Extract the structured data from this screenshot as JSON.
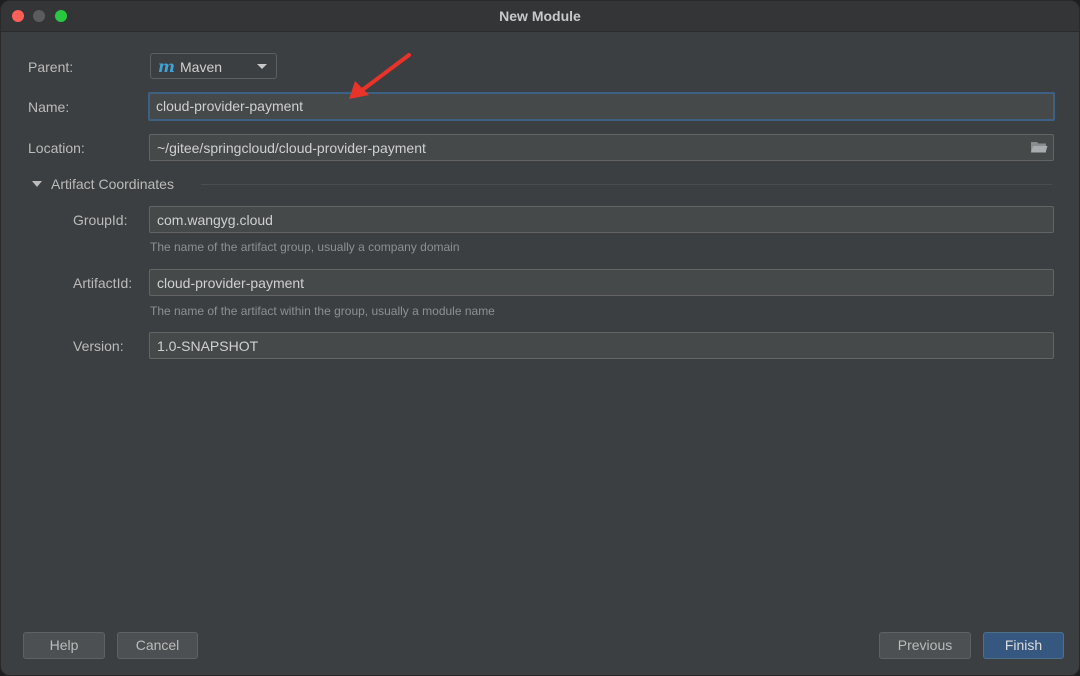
{
  "window": {
    "title": "New Module"
  },
  "form": {
    "parent_label": "Parent:",
    "parent_value": "Maven",
    "parent_icon": "maven-m-icon",
    "name_label": "Name:",
    "name_value": "cloud-provider-payment",
    "location_label": "Location:",
    "location_value": "~/gitee/springcloud/cloud-provider-payment",
    "section_title": "Artifact Coordinates",
    "groupid_label": "GroupId:",
    "groupid_value": "com.wangyg.cloud",
    "groupid_hint": "The name of the artifact group, usually a company domain",
    "artifactid_label": "ArtifactId:",
    "artifactid_value": "cloud-provider-payment",
    "artifactid_hint": "The name of the artifact within the group, usually a module name",
    "version_label": "Version:",
    "version_value": "1.0-SNAPSHOT"
  },
  "buttons": {
    "help": "Help",
    "cancel": "Cancel",
    "previous": "Previous",
    "finish": "Finish"
  },
  "colors": {
    "accent": "#365880",
    "focus_border": "#3d6185",
    "annotation_arrow": "#e8332a",
    "maven_icon": "#3fa3d9"
  }
}
